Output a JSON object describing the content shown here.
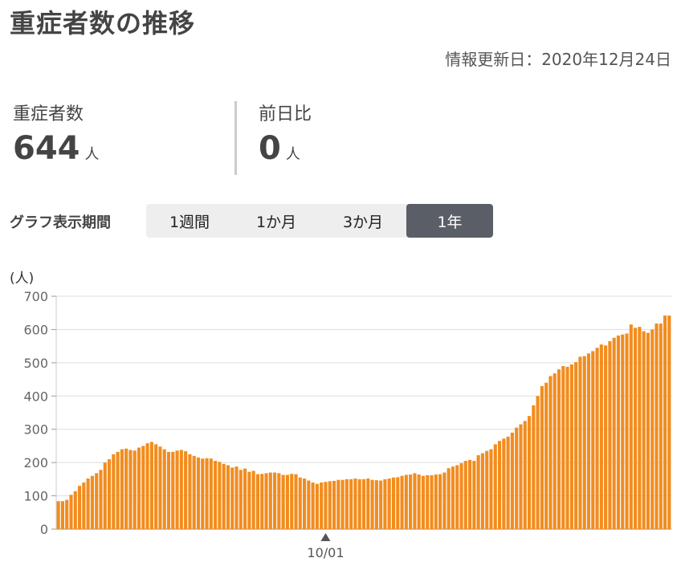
{
  "title": "重症者数の推移",
  "updated": "情報更新日：2020年12月24日",
  "stats": [
    {
      "label": "重症者数",
      "value": "644",
      "unit": "人"
    },
    {
      "label": "前日比",
      "value": "0",
      "unit": "人"
    }
  ],
  "period": {
    "label": "グラフ表示期間",
    "options": [
      "1週間",
      "1か月",
      "3か月",
      "1年"
    ],
    "selected": "1年"
  },
  "colors": {
    "bar": "#f28c1e",
    "selected_button": "#5a5e66"
  },
  "chart_data": {
    "type": "bar",
    "unit_label": "(人)",
    "ylim": [
      0,
      700
    ],
    "yticks": [
      0,
      100,
      200,
      300,
      400,
      500,
      600,
      700
    ],
    "grid": true,
    "marker": {
      "index": 63,
      "label": "10/01"
    },
    "values": [
      84,
      84,
      88,
      103,
      114,
      130,
      140,
      152,
      160,
      168,
      178,
      200,
      210,
      225,
      232,
      240,
      242,
      238,
      236,
      245,
      250,
      258,
      262,
      255,
      248,
      240,
      232,
      232,
      236,
      238,
      234,
      225,
      220,
      215,
      212,
      213,
      212,
      205,
      202,
      196,
      192,
      185,
      188,
      178,
      182,
      172,
      175,
      165,
      166,
      168,
      170,
      170,
      168,
      163,
      163,
      166,
      165,
      155,
      152,
      146,
      140,
      136,
      140,
      142,
      144,
      145,
      148,
      148,
      150,
      150,
      152,
      150,
      150,
      152,
      148,
      147,
      146,
      150,
      152,
      155,
      156,
      160,
      163,
      164,
      168,
      164,
      160,
      162,
      162,
      164,
      165,
      170,
      183,
      188,
      192,
      198,
      205,
      208,
      205,
      222,
      228,
      235,
      240,
      255,
      265,
      272,
      278,
      290,
      305,
      315,
      325,
      340,
      372,
      400,
      430,
      440,
      460,
      468,
      480,
      490,
      488,
      495,
      502,
      518,
      520,
      528,
      535,
      545,
      555,
      552,
      565,
      575,
      582,
      585,
      588,
      615,
      605,
      608,
      595,
      590,
      600,
      618,
      618,
      642,
      642
    ]
  }
}
